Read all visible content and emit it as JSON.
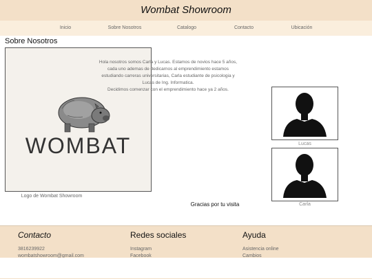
{
  "header": {
    "title": "Wombat Showroom"
  },
  "nav": {
    "items": [
      "Inicio",
      "Sobre Nosotros",
      "Catalogo",
      "Contacto",
      "Ubicación"
    ]
  },
  "about": {
    "section_title": "Sobre Nosotros",
    "logo_text": "WOMBAT",
    "logo_caption": "Logo de Wombat Showroom",
    "intro_lines": [
      "Hola nosotros somos Carla y Lucas. Estamos de novios hace 5 años,",
      "cada uno ademas de dedicarnos al emprendimiento estamos",
      "estudiando carreras universitarias, Carla estudiante de psicologia y",
      "Lucas de Ing. Informatica.",
      "Decidimos comenzar con el emprendimiento hace ya 2 años."
    ],
    "profiles": [
      {
        "name": "Lucas",
        "icon": "person-silhouette-icon"
      },
      {
        "name": "Carla",
        "icon": "person-silhouette-icon"
      }
    ],
    "thanks": "Gracias por tu visita"
  },
  "footer": {
    "contact": {
      "title": "Contacto",
      "phone": "3816239922",
      "email": "wombatshowroom@gmail.com"
    },
    "social": {
      "title": "Redes sociales",
      "items": [
        "Instagram",
        "Facebook"
      ]
    },
    "help": {
      "title": "Ayuda",
      "items": [
        "Asistencia online",
        "Cambios"
      ]
    }
  },
  "colors": {
    "header_bg": "#f3e0c8",
    "nav_bg": "#faeedd",
    "footer_bg": "#f3e0c8"
  }
}
